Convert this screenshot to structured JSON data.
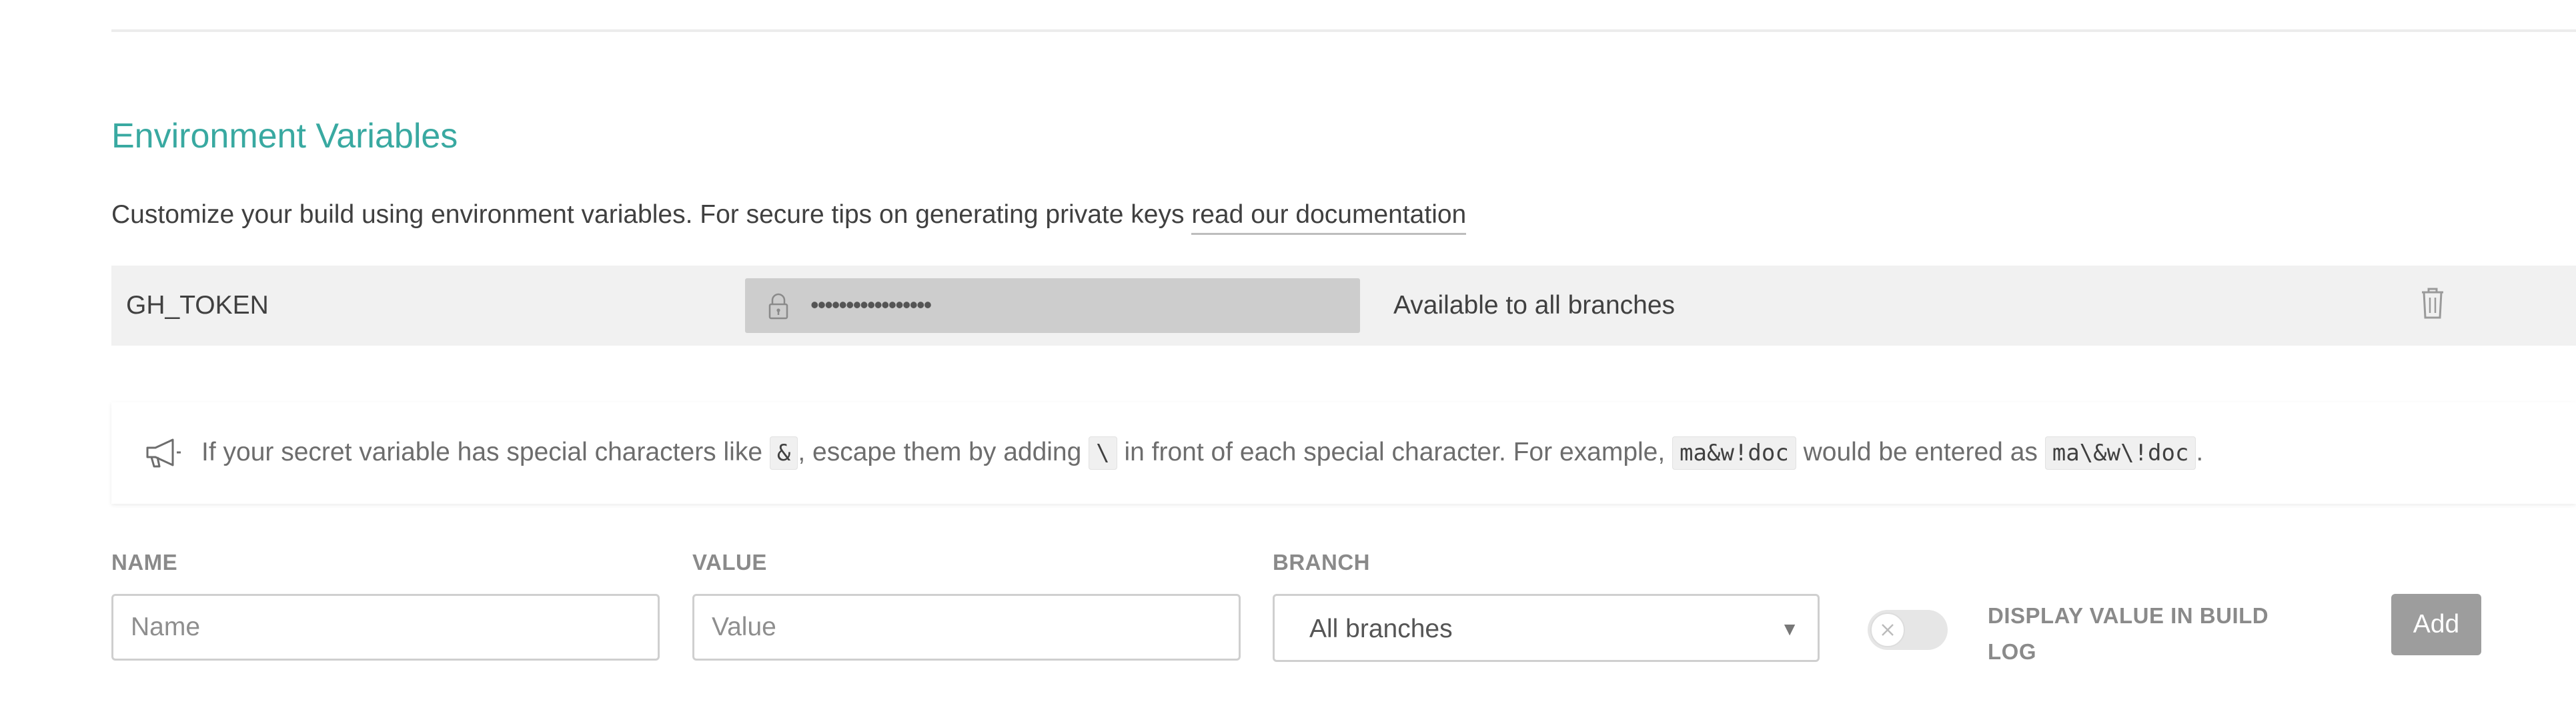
{
  "section": {
    "title": "Environment Variables",
    "description_prefix": "Customize your build using environment variables. For secure tips on generating private keys ",
    "doc_link_label": "read our documentation"
  },
  "variables": [
    {
      "name": "GH_TOKEN",
      "value_masked": "•••••••••••••••••",
      "branch": "Available to all branches"
    }
  ],
  "notice": {
    "text_1": "If your secret variable has special characters like ",
    "code_1": "&",
    "text_2": ", escape them by adding ",
    "code_2": "\\",
    "text_3": " in front of each special character. For example, ",
    "code_3": "ma&w!doc",
    "text_4": " would be entered as ",
    "code_4": "ma\\&w\\!doc",
    "text_5": "."
  },
  "form": {
    "name_label": "NAME",
    "name_placeholder": "Name",
    "value_label": "VALUE",
    "value_placeholder": "Value",
    "branch_label": "BRANCH",
    "branch_selected": "All branches",
    "toggle_label": "DISPLAY VALUE IN BUILD LOG",
    "toggle_on": false,
    "add_label": "Add"
  },
  "icons": {
    "lock": "lock-icon",
    "trash": "trash-icon",
    "megaphone": "megaphone-icon",
    "chevron": "chevron-down-icon",
    "toggle_off": "close-icon"
  },
  "colors": {
    "accent": "#39a9a1",
    "add_button": "#9d9d9d"
  }
}
